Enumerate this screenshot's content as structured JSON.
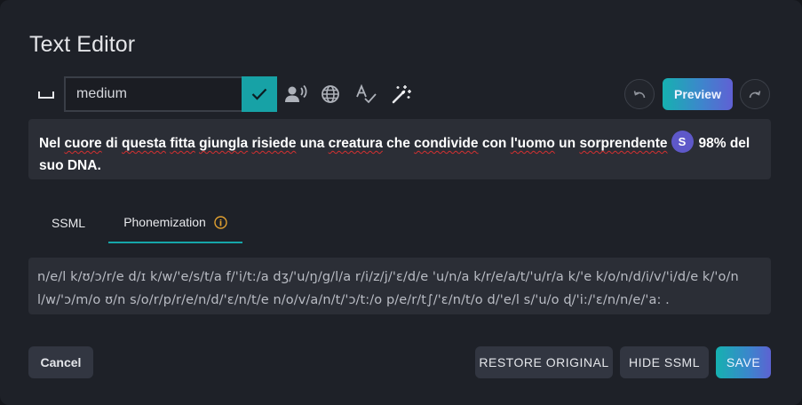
{
  "dialog": {
    "title": "Text Editor"
  },
  "toolbar": {
    "search_value": "medium",
    "preview_label": "Preview"
  },
  "editor": {
    "segments": [
      {
        "text": "Nel ",
        "spell": false
      },
      {
        "text": "cuore",
        "spell": true
      },
      {
        "text": " di ",
        "spell": false
      },
      {
        "text": "questa",
        "spell": true
      },
      {
        "text": " ",
        "spell": false
      },
      {
        "text": "fitta",
        "spell": true
      },
      {
        "text": " ",
        "spell": false
      },
      {
        "text": "giungla",
        "spell": true
      },
      {
        "text": " ",
        "spell": false
      },
      {
        "text": "risiede",
        "spell": true
      },
      {
        "text": " una ",
        "spell": false
      },
      {
        "text": "creatura",
        "spell": true
      },
      {
        "text": " che ",
        "spell": false
      },
      {
        "text": "condivide",
        "spell": true
      },
      {
        "text": " con ",
        "spell": false
      },
      {
        "text": "l'uomo",
        "spell": true
      },
      {
        "text": " un ",
        "spell": false
      },
      {
        "text": "sorprendente",
        "spell": true
      }
    ],
    "badge_letter": "S",
    "after_badge": "98% del suo DNA."
  },
  "tabs": [
    {
      "label": "SSML"
    },
    {
      "label": "Phonemization",
      "info_symbol": "i"
    }
  ],
  "phonemes": "n/e/l k/ʊ/ɔ/r/e d/ɪ k/w/'e/s/t/a f/'i/t:/a dʒ/'u/ŋ/g/l/a r/i/z/j/'ɛ/d/e 'u/n/a k/r/e/a/t/'u/r/a k/'e k/o/n/d/i/v/'i/d/e k/'o/n l/w/'ɔ/m/o ʊ/n s/o/r/p/r/e/n/d/'ɛ/n/t/e n/o/v/a/n/t/'ɔ/t:/o p/e/r/t∫/'ɛ/n/t/o d/'e/l s/'u/o ɖ/'i:/'ɛ/n/n/e/'a: .",
  "footer": {
    "cancel": "Cancel",
    "restore": "RESTORE ORIGINAL",
    "hide_ssml": "HIDE SSML",
    "save": "SAVE"
  },
  "colors": {
    "accent": "#17a2a6",
    "badge": "#5e58c9",
    "info": "#e0a030"
  }
}
